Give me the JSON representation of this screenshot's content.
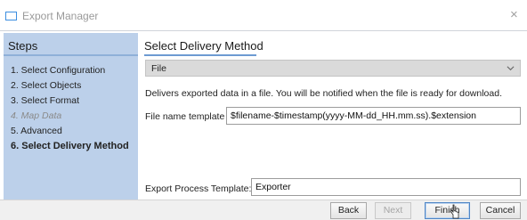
{
  "window": {
    "title": "Export Manager",
    "close_glyph": "×",
    "icon": "window-icon",
    "accent": "#3c8ee0"
  },
  "sidebar": {
    "heading": "Steps",
    "background": "#bcd0ea",
    "steps": [
      {
        "label": "1. Select Configuration",
        "state": "normal"
      },
      {
        "label": "2. Select Objects",
        "state": "normal"
      },
      {
        "label": "3. Select Format",
        "state": "normal"
      },
      {
        "label": "4. Map Data",
        "state": "disabled"
      },
      {
        "label": "5. Advanced",
        "state": "normal"
      },
      {
        "label": "6. Select Delivery Method",
        "state": "active"
      }
    ]
  },
  "main": {
    "heading": "Select Delivery Method",
    "delivery_select": {
      "value": "File",
      "icon": "chevron-down-icon"
    },
    "description": "Delivers exported data in a file. You will be notified when the file is ready for download.",
    "file_name_template": {
      "label": "File name template",
      "value": "$filename-$timestamp(yyyy-MM-dd_HH.mm.ss).$extension"
    },
    "export_process_template": {
      "label": "Export Process Template:",
      "value": "Exporter"
    }
  },
  "footer": {
    "back_label": "Back",
    "next_label": "Next",
    "finish_label": "Finish",
    "cancel_label": "Cancel"
  }
}
